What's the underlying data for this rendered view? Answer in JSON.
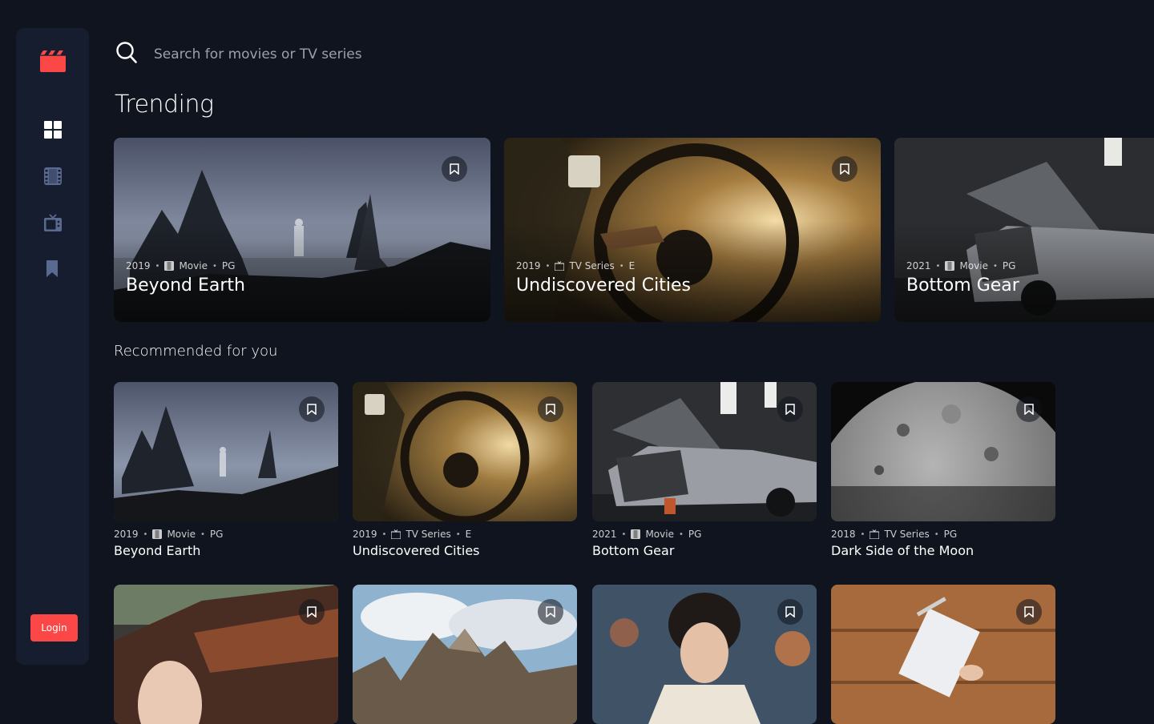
{
  "search": {
    "placeholder": "Search for movies or TV series"
  },
  "sidebar": {
    "nav": [
      {
        "name": "nav-home",
        "icon": "grid-icon"
      },
      {
        "name": "nav-movies",
        "icon": "film-icon"
      },
      {
        "name": "nav-tv-series",
        "icon": "tv-icon"
      },
      {
        "name": "nav-bookmarks",
        "icon": "bookmark-icon"
      }
    ],
    "login_label": "Login"
  },
  "colors": {
    "accent": "#FC4747",
    "background": "#10141E",
    "surface": "#161D2F",
    "nav_icon": "#5A698F"
  },
  "trending": {
    "heading": "Trending",
    "items": [
      {
        "year": "2019",
        "category": "Movie",
        "rating": "PG",
        "title": "Beyond Earth"
      },
      {
        "year": "2019",
        "category": "TV Series",
        "rating": "E",
        "title": "Undiscovered Cities"
      },
      {
        "year": "2021",
        "category": "Movie",
        "rating": "PG",
        "title": "Bottom Gear"
      }
    ]
  },
  "recommended": {
    "heading": "Recommended for you",
    "items": [
      {
        "year": "2019",
        "category": "Movie",
        "rating": "PG",
        "title": "Beyond Earth"
      },
      {
        "year": "2019",
        "category": "TV Series",
        "rating": "E",
        "title": "Undiscovered Cities"
      },
      {
        "year": "2021",
        "category": "Movie",
        "rating": "PG",
        "title": "Bottom Gear"
      },
      {
        "year": "2018",
        "category": "TV Series",
        "rating": "PG",
        "title": "Dark Side of the Moon"
      }
    ]
  }
}
